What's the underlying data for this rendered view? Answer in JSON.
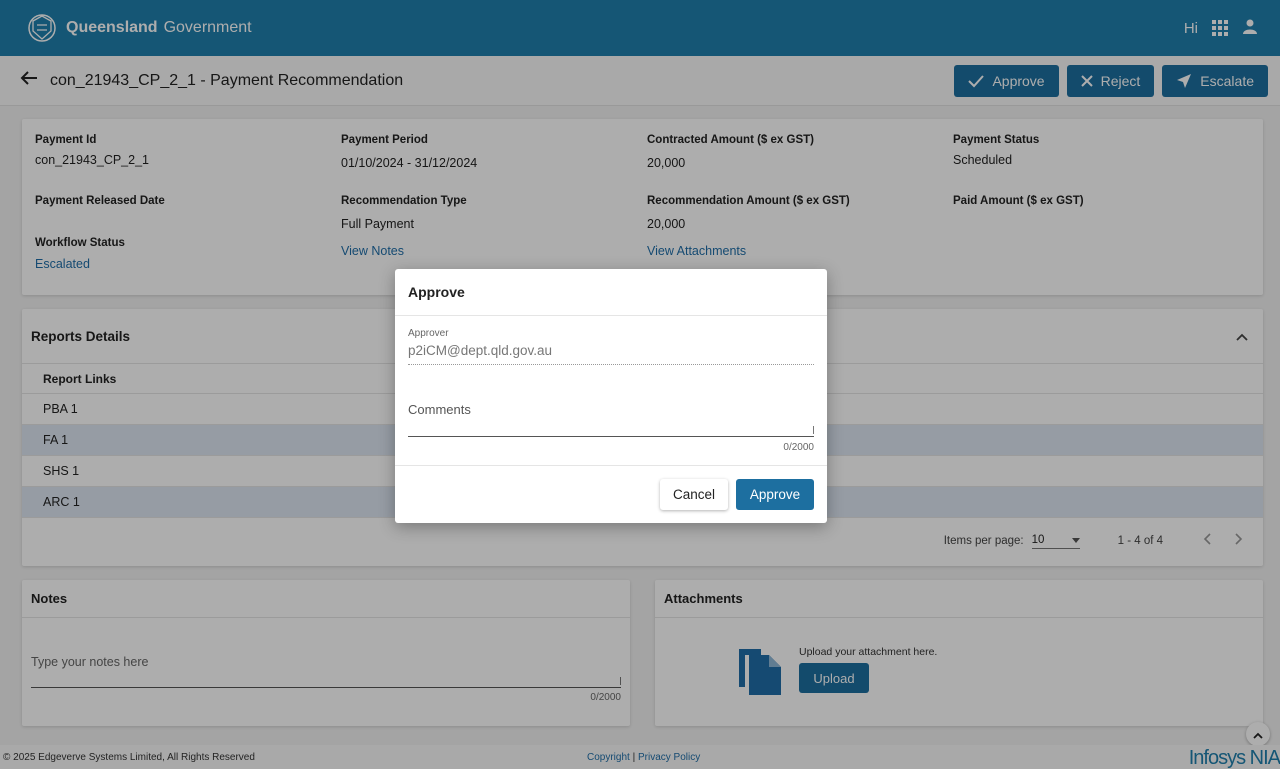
{
  "header": {
    "brand_bold": "Queensland",
    "brand_light": "Government",
    "greeting": "Hi"
  },
  "titlebar": {
    "title": "con_21943_CP_2_1 - Payment Recommendation",
    "actions": {
      "approve": "Approve",
      "reject": "Reject",
      "escalate": "Escalate"
    }
  },
  "summary": {
    "payment_id_label": "Payment Id",
    "payment_id": "con_21943_CP_2_1",
    "payment_period_label": "Payment Period",
    "payment_period": "01/10/2024 - 31/12/2024",
    "contracted_amount_label": "Contracted Amount ($ ex GST)",
    "contracted_amount": "20,000",
    "payment_status_label": "Payment Status",
    "payment_status": "Scheduled",
    "released_date_label": "Payment Released Date",
    "recommendation_type_label": "Recommendation Type",
    "recommendation_type": "Full Payment",
    "recommendation_amount_label": "Recommendation Amount ($ ex GST)",
    "recommendation_amount": "20,000",
    "paid_amount_label": "Paid Amount ($ ex GST)",
    "workflow_status_label": "Workflow Status",
    "workflow_status": "Escalated",
    "view_notes": "View Notes",
    "view_attachments": "View Attachments"
  },
  "reports": {
    "title": "Reports Details",
    "column": "Report Links",
    "rows": [
      "PBA 1",
      "FA 1",
      "SHS 1",
      "ARC 1"
    ],
    "items_per_page_label": "Items per page:",
    "items_per_page": "10",
    "range": "1 - 4 of 4"
  },
  "notes": {
    "title": "Notes",
    "placeholder": "Type your notes here",
    "counter": "0/2000"
  },
  "attachments": {
    "title": "Attachments",
    "upload_text": "Upload your attachment here.",
    "upload_button": "Upload"
  },
  "footer": {
    "copyright": "© 2025 Edgeverve Systems Limited, All Rights Reserved",
    "copyright_link": "Copyright",
    "separator": "|",
    "privacy_link": "Privacy Policy",
    "logo_text": "Infosys NIA"
  },
  "dialog": {
    "title": "Approve",
    "approver_label": "Approver",
    "approver_value": "p2iCM@dept.qld.gov.au",
    "comments_placeholder": "Comments",
    "counter": "0/2000",
    "cancel": "Cancel",
    "approve": "Approve"
  }
}
